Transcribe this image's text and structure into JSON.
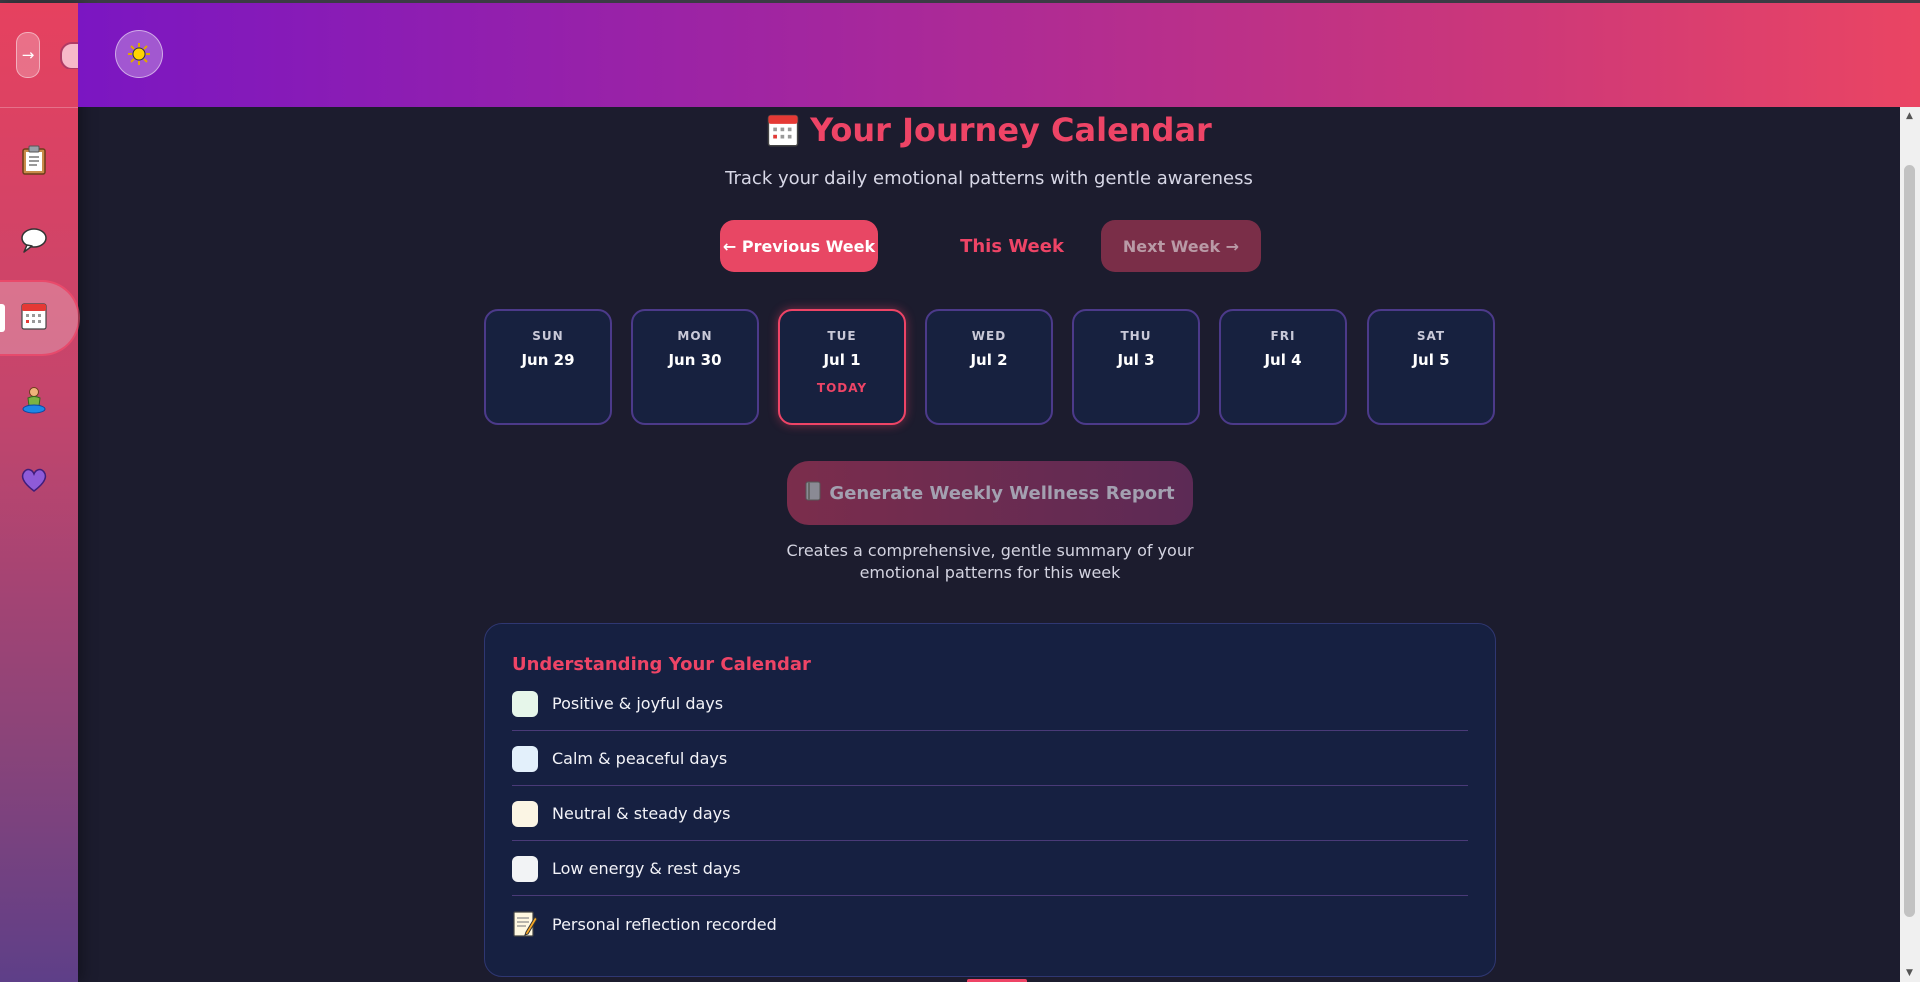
{
  "sidebar": {
    "toggle_glyph": "→",
    "items": [
      {
        "name": "clipboard-icon"
      },
      {
        "name": "chat-bubble-icon"
      },
      {
        "name": "calendar-icon",
        "active": true
      },
      {
        "name": "meditation-icon"
      },
      {
        "name": "heart-icon"
      }
    ]
  },
  "header": {
    "theme_icon": "sun-icon"
  },
  "page": {
    "title": "Your Journey Calendar",
    "subtitle": "Track your daily emotional patterns with gentle awareness"
  },
  "week_nav": {
    "previous_label": "← Previous Week",
    "current_label": "This Week",
    "next_label": "Next Week →"
  },
  "days": [
    {
      "dow": "SUN",
      "date": "Jun 29"
    },
    {
      "dow": "MON",
      "date": "Jun 30"
    },
    {
      "dow": "TUE",
      "date": "Jul 1",
      "badge": "TODAY"
    },
    {
      "dow": "WED",
      "date": "Jul 2"
    },
    {
      "dow": "THU",
      "date": "Jul 3"
    },
    {
      "dow": "FRI",
      "date": "Jul 4"
    },
    {
      "dow": "SAT",
      "date": "Jul 5"
    }
  ],
  "report": {
    "button_label": "Generate Weekly Wellness Report",
    "description": "Creates a comprehensive, gentle summary of your emotional patterns for this week"
  },
  "legend": {
    "title": "Understanding Your Calendar",
    "items": [
      {
        "label": "Positive & joyful days",
        "color": "#e6f6ea"
      },
      {
        "label": "Calm & peaceful days",
        "color": "#e3f0fb"
      },
      {
        "label": "Neutral & steady days",
        "color": "#fbf5e4"
      },
      {
        "label": "Low energy & rest days",
        "color": "#f2f3f5"
      },
      {
        "label": "Personal reflection recorded",
        "icon": "memo-icon"
      }
    ]
  },
  "colors": {
    "accent": "#ee4466",
    "background": "#1c1c2e",
    "card": "#17213f",
    "card_border": "#4c3a8a"
  }
}
